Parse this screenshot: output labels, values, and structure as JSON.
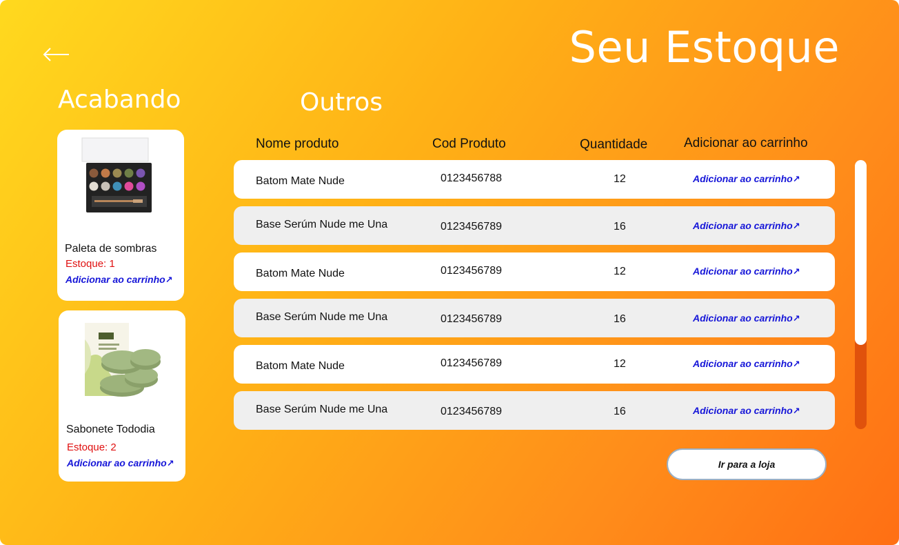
{
  "header": {
    "title": "Seu Estoque",
    "back_icon": "arrow-left-icon"
  },
  "low_stock": {
    "title": "Acabando",
    "items": [
      {
        "name": "Paleta de sombras",
        "stock": "Estoque: 1",
        "add_label": "Adicionar ao carrinho",
        "image_icon": "eyeshadow-palette-image"
      },
      {
        "name": "Sabonete Tododia",
        "stock": "Estoque: 2",
        "add_label": "Adicionar ao carrinho",
        "image_icon": "soap-bars-image"
      }
    ]
  },
  "others": {
    "title": "Outros",
    "columns": [
      "Nome produto",
      "Cod Produto",
      "Quantidade",
      "Adicionar ao carrinho"
    ],
    "rows": [
      {
        "name": "Batom Mate Nude",
        "code": "0123456788",
        "qty": "12",
        "add_label": "Adicionar ao carrinho"
      },
      {
        "name": "Base Serúm Nude me Una",
        "code": "0123456789",
        "qty": "16",
        "add_label": "Adicionar ao carrinho"
      },
      {
        "name": "Batom Mate Nude",
        "code": "0123456789",
        "qty": "12",
        "add_label": "Adicionar ao carrinho"
      },
      {
        "name": "Base Serúm Nude me Una",
        "code": "0123456789",
        "qty": "16",
        "add_label": "Adicionar ao carrinho"
      },
      {
        "name": "Batom Mate Nude",
        "code": "0123456789",
        "qty": "12",
        "add_label": "Adicionar ao carrinho"
      },
      {
        "name": "Base Serúm Nude me Una",
        "code": "0123456789",
        "qty": "16",
        "add_label": "Adicionar ao carrinho"
      }
    ],
    "external_link_icon": "arrow-up-right-icon",
    "scroll_position": 0
  },
  "footer": {
    "shop_button": "Ir para a loja"
  },
  "colors": {
    "gradient_start": "#ffd91e",
    "gradient_end": "#ff6f14",
    "stock_red": "#e01010",
    "link_blue": "#1515d8",
    "scroll_track": "#e0520c"
  }
}
